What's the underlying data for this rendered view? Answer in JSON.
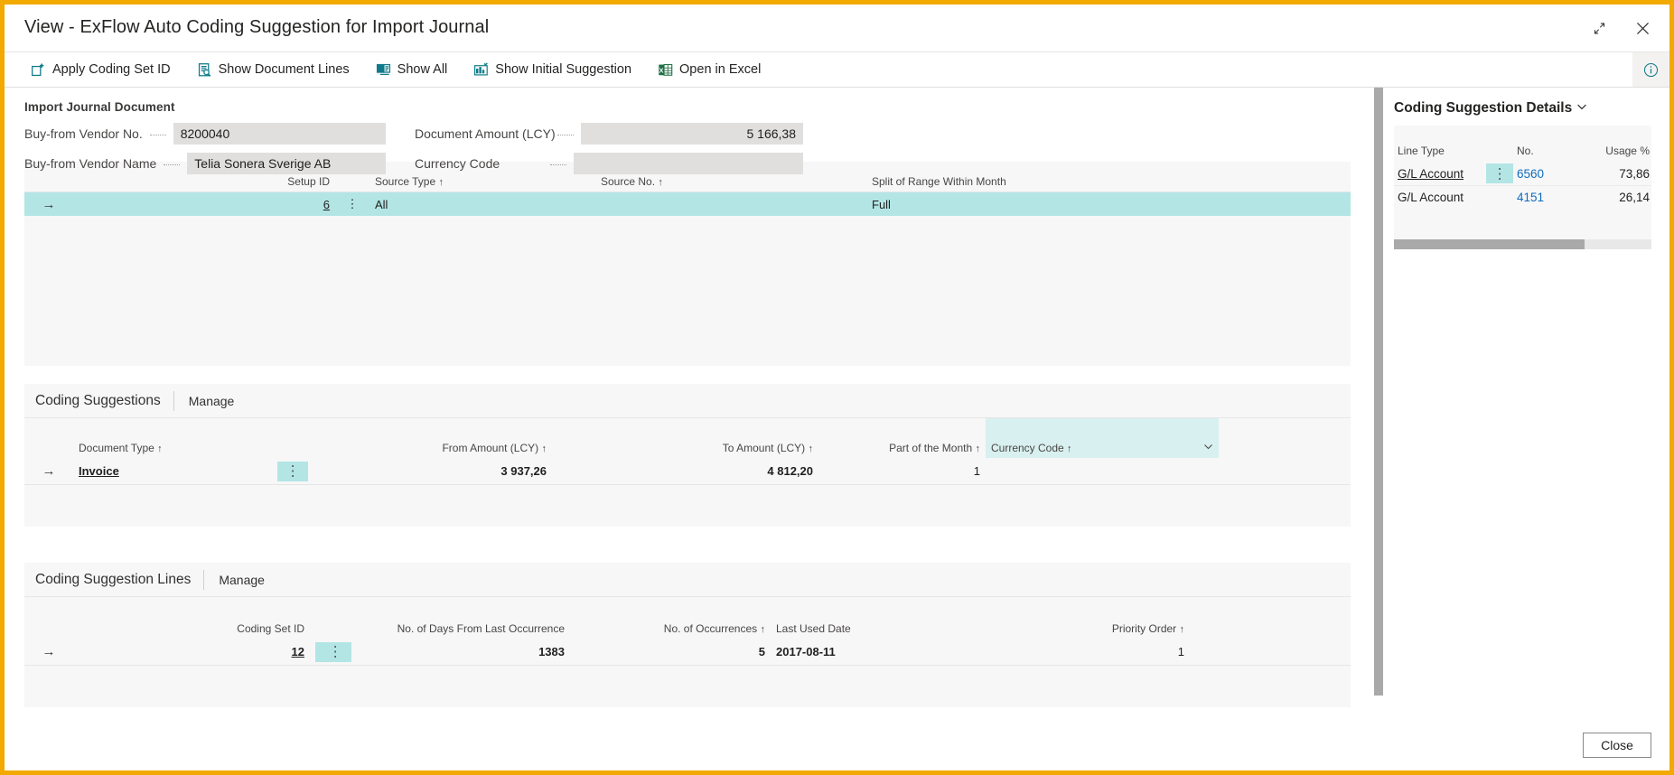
{
  "window": {
    "title": "View - ExFlow Auto Coding Suggestion for Import Journal",
    "restore_icon": "restore-down-icon",
    "close_icon": "close-icon",
    "accent_border": "#F2A900"
  },
  "toolbar": {
    "items": [
      {
        "label": "Apply Coding Set ID",
        "icon": "apply-coding-set-icon"
      },
      {
        "label": "Show Document Lines",
        "icon": "show-document-lines-icon"
      },
      {
        "label": "Show All",
        "icon": "show-all-icon"
      },
      {
        "label": "Show Initial Suggestion",
        "icon": "show-initial-suggestion-icon"
      },
      {
        "label": "Open in Excel",
        "icon": "excel-icon"
      }
    ],
    "info_icon": "info-icon"
  },
  "header_fields": {
    "group_caption": "Import Journal Document",
    "rows": [
      {
        "left_label": "Buy-from Vendor No.",
        "left_value": "8200040",
        "right_label": "Document Amount (LCY)",
        "right_value": "5 166,38",
        "right_align": "right"
      },
      {
        "left_label": "Buy-from Vendor Name",
        "left_value": "Telia Sonera Sverige AB",
        "right_label": "Currency Code",
        "right_value": "",
        "right_align": "left"
      }
    ]
  },
  "setup_grid": {
    "columns": [
      {
        "label": "Setup ID",
        "sort": ""
      },
      {
        "label": "Source Type",
        "sort": "↑"
      },
      {
        "label": "Source No.",
        "sort": "↑"
      },
      {
        "label": "Split of Range Within Month",
        "sort": ""
      }
    ],
    "row": {
      "row_indicator": "→",
      "setup_id": "6",
      "ellipsis": "⋮",
      "source_type": "All",
      "source_no": "",
      "split_of_range": "Full"
    }
  },
  "coding_suggestions": {
    "section_title": "Coding Suggestions",
    "tab_label": "Manage",
    "columns": [
      {
        "label": "Document Type",
        "sort": "↑"
      },
      {
        "label": "From Amount (LCY)",
        "sort": "↑"
      },
      {
        "label": "To Amount (LCY)",
        "sort": "↑"
      },
      {
        "label": "Part of the Month",
        "sort": "↑"
      },
      {
        "label": "Currency Code",
        "sort": "↑"
      }
    ],
    "dropdown_icon": "chevron-down-icon",
    "row": {
      "row_indicator": "→",
      "document_type": "Invoice",
      "ellipsis": "⋮",
      "from_amount": "3 937,26",
      "to_amount": "4 812,20",
      "part_of_the_month": "1",
      "currency_code": ""
    }
  },
  "coding_suggestion_lines": {
    "section_title": "Coding Suggestion Lines",
    "tab_label": "Manage",
    "columns": [
      {
        "label": "Coding Set ID",
        "sort": ""
      },
      {
        "label": "No. of Days From Last Occurrence",
        "sort": ""
      },
      {
        "label": "No. of Occurrences",
        "sort": "↑"
      },
      {
        "label": "Last Used Date",
        "sort": ""
      },
      {
        "label": "Priority Order",
        "sort": "↑"
      }
    ],
    "row": {
      "row_indicator": "→",
      "coding_set_id": "12",
      "ellipsis": "⋮",
      "days_from_last_occurrence": "1383",
      "no_of_occurrences": "5",
      "last_used_date": "2017-08-11",
      "priority_order": "1"
    }
  },
  "side_panel": {
    "title": "Coding Suggestion Details",
    "collapse_icon": "chevron-down-icon",
    "columns": [
      "Line Type",
      "No.",
      "Usage %"
    ],
    "rows": [
      {
        "line_type": "G/L Account",
        "ellipsis": "⋮",
        "no": "6560",
        "usage": "73,86",
        "selected": true
      },
      {
        "line_type": "G/L Account",
        "ellipsis": "",
        "no": "4151",
        "usage": "26,14",
        "selected": false
      }
    ]
  },
  "footer": {
    "close_label": "Close"
  }
}
